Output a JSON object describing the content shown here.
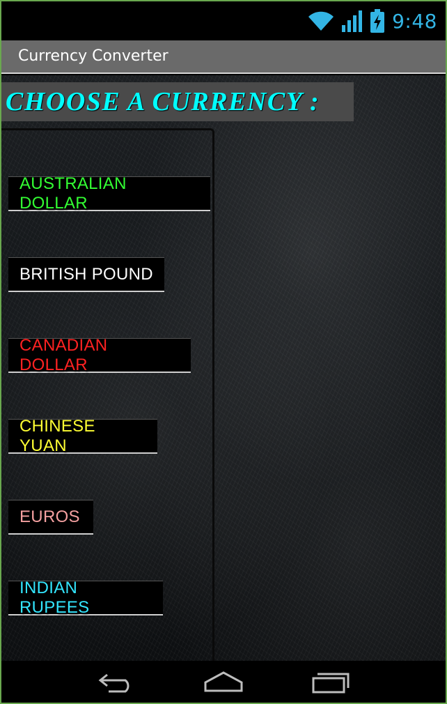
{
  "status_bar": {
    "time": "9:48",
    "icons": [
      "wifi-icon",
      "signal-icon",
      "battery-charging-icon"
    ],
    "accent_color": "#33b5e5"
  },
  "action_bar": {
    "title": "Currency Converter"
  },
  "heading": {
    "text": "CHOOSE A CURRENCY :",
    "color": "#00ffff"
  },
  "currencies": [
    {
      "label": "AUSTRALIAN DOLLAR",
      "color": "#33ff33"
    },
    {
      "label": "BRITISH POUND",
      "color": "#ffffff"
    },
    {
      "label": "CANADIAN DOLLAR",
      "color": "#ff2222"
    },
    {
      "label": "CHINESE YUAN",
      "color": "#ffff33"
    },
    {
      "label": "EUROS",
      "color": "#f4a0a0"
    },
    {
      "label": "INDIAN RUPEES",
      "color": "#33e6ff"
    }
  ],
  "nav_bar": {
    "icons": [
      "back-icon",
      "home-icon",
      "recent-apps-icon"
    ]
  }
}
